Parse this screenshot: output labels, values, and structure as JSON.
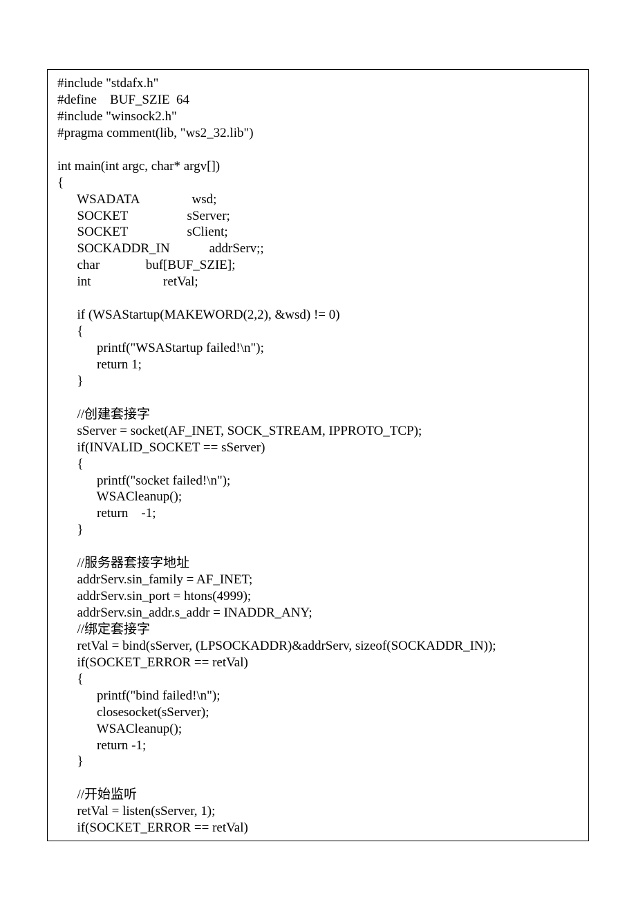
{
  "code": {
    "lines": [
      "#include \"stdafx.h\"",
      "#define    BUF_SZIE  64",
      "#include \"winsock2.h\"",
      "#pragma comment(lib, \"ws2_32.lib\")",
      "",
      "int main(int argc, char* argv[])",
      "{",
      "      WSADATA                wsd;",
      "      SOCKET                  sServer;",
      "      SOCKET                  sClient;",
      "      SOCKADDR_IN            addrServ;;",
      "      char              buf[BUF_SZIE];",
      "      int                      retVal;",
      "",
      "      if (WSAStartup(MAKEWORD(2,2), &wsd) != 0)",
      "      {",
      "            printf(\"WSAStartup failed!\\n\");",
      "            return 1;",
      "      }",
      "",
      "      //创建套接字",
      "      sServer = socket(AF_INET, SOCK_STREAM, IPPROTO_TCP);",
      "      if(INVALID_SOCKET == sServer)",
      "      {",
      "            printf(\"socket failed!\\n\");",
      "            WSACleanup();",
      "            return    -1;",
      "      }",
      "",
      "      //服务器套接字地址",
      "      addrServ.sin_family = AF_INET;",
      "      addrServ.sin_port = htons(4999);",
      "      addrServ.sin_addr.s_addr = INADDR_ANY;",
      "      //绑定套接字",
      "      retVal = bind(sServer, (LPSOCKADDR)&addrServ, sizeof(SOCKADDR_IN));",
      "      if(SOCKET_ERROR == retVal)",
      "      {",
      "            printf(\"bind failed!\\n\");",
      "            closesocket(sServer);",
      "            WSACleanup();",
      "            return -1;",
      "      }",
      "",
      "      //开始监听",
      "      retVal = listen(sServer, 1);",
      "      if(SOCKET_ERROR == retVal)"
    ]
  }
}
